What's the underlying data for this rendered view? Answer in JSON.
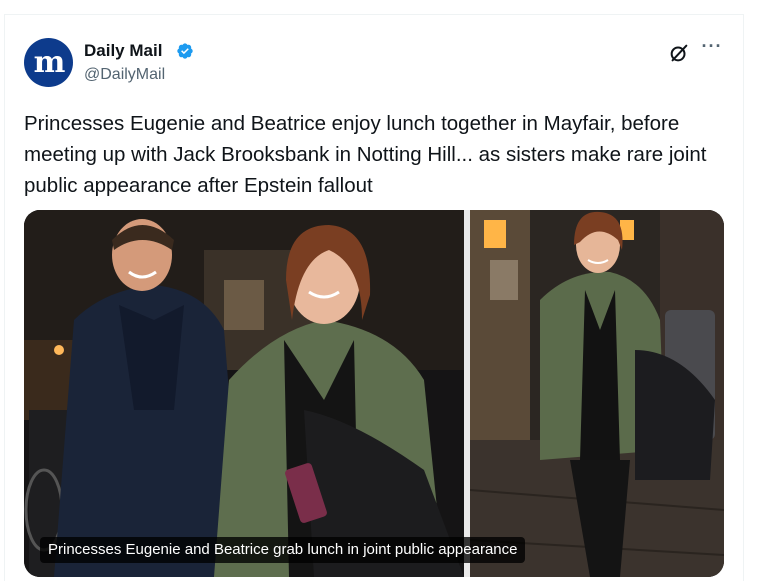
{
  "author": {
    "name": "Daily Mail",
    "handle": "@DailyMail",
    "avatar_letter": "m",
    "avatar_color": "#0d3b8c",
    "verified": true,
    "verified_color": "#1d9bf0"
  },
  "tweet": {
    "text": "Princesses Eugenie and Beatrice enjoy lunch together in Mayfair, before meeting up with Jack Brooksbank in Notting Hill... as sisters make rare joint public appearance after Epstein fallout"
  },
  "media": {
    "caption": "Princesses Eugenie and Beatrice grab lunch in joint public appearance",
    "photo_count": 2
  },
  "actions": {
    "grok_icon": "grok-icon",
    "more_icon": "more-options-icon",
    "more_glyph": "···"
  }
}
